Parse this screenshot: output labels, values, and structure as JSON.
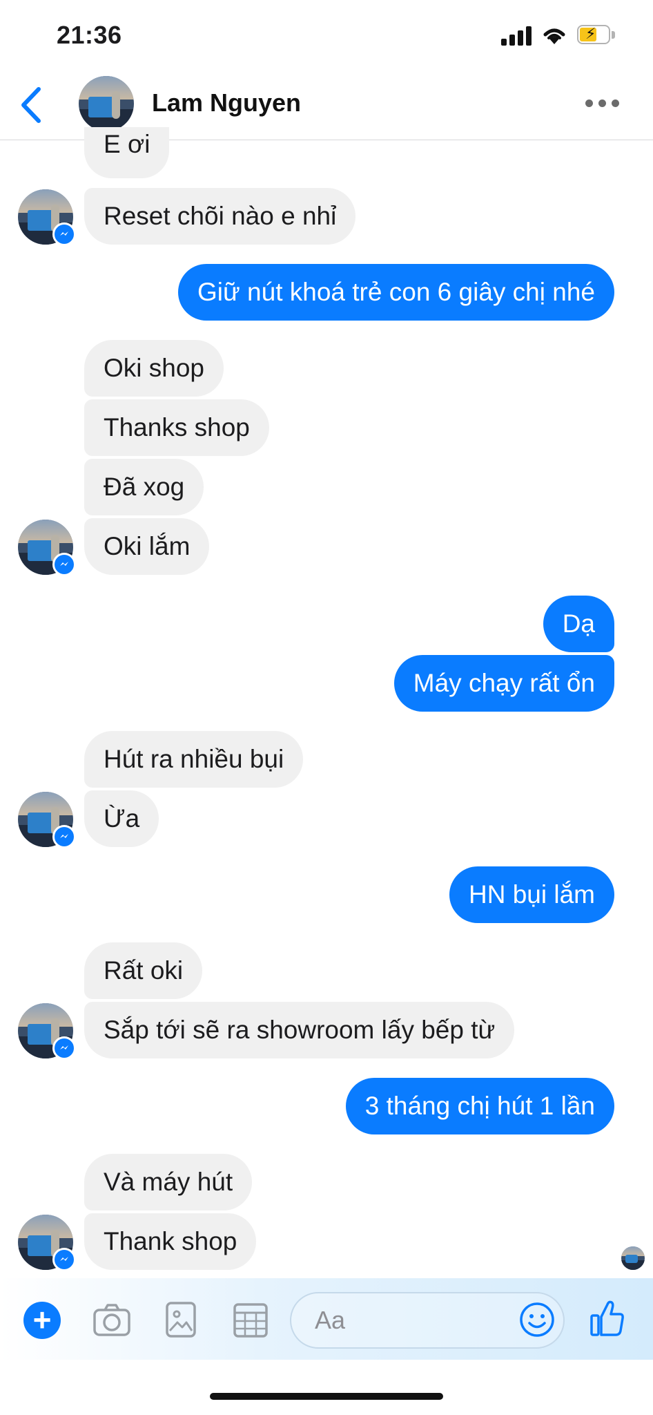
{
  "status_bar": {
    "time": "21:36"
  },
  "header": {
    "contact_name": "Lam Nguyen"
  },
  "messages": [
    {
      "from": "them",
      "text": "E ơi"
    },
    {
      "from": "them",
      "text": "Reset chõi nào e nhỉ"
    },
    {
      "from": "me",
      "text": "Giữ nút khoá trẻ con 6 giây chị nhé"
    },
    {
      "from": "them",
      "text": "Oki shop"
    },
    {
      "from": "them",
      "text": "Thanks shop"
    },
    {
      "from": "them",
      "text": "Đã xog"
    },
    {
      "from": "them",
      "text": "Oki lắm"
    },
    {
      "from": "me",
      "text": "Dạ"
    },
    {
      "from": "me",
      "text": "Máy chạy rất ổn"
    },
    {
      "from": "them",
      "text": "Hút ra nhiều bụi"
    },
    {
      "from": "them",
      "text": "Ừa"
    },
    {
      "from": "me",
      "text": "HN bụi lắm"
    },
    {
      "from": "them",
      "text": "Rất oki"
    },
    {
      "from": "them",
      "text": "Sắp tới sẽ ra showroom lấy bếp từ"
    },
    {
      "from": "me",
      "text": "3 tháng chị hút 1 lần"
    },
    {
      "from": "them",
      "text": "Và máy hút"
    },
    {
      "from": "them",
      "text": "Thank shop"
    }
  ],
  "composer": {
    "placeholder": "Aa",
    "icons": [
      "plus-icon",
      "camera-icon",
      "gallery-icon",
      "grid-icon",
      "emoji-icon",
      "thumbs-up-icon"
    ]
  },
  "colors": {
    "accent": "#0a7cff",
    "incoming_bubble": "#f0f0f0"
  }
}
